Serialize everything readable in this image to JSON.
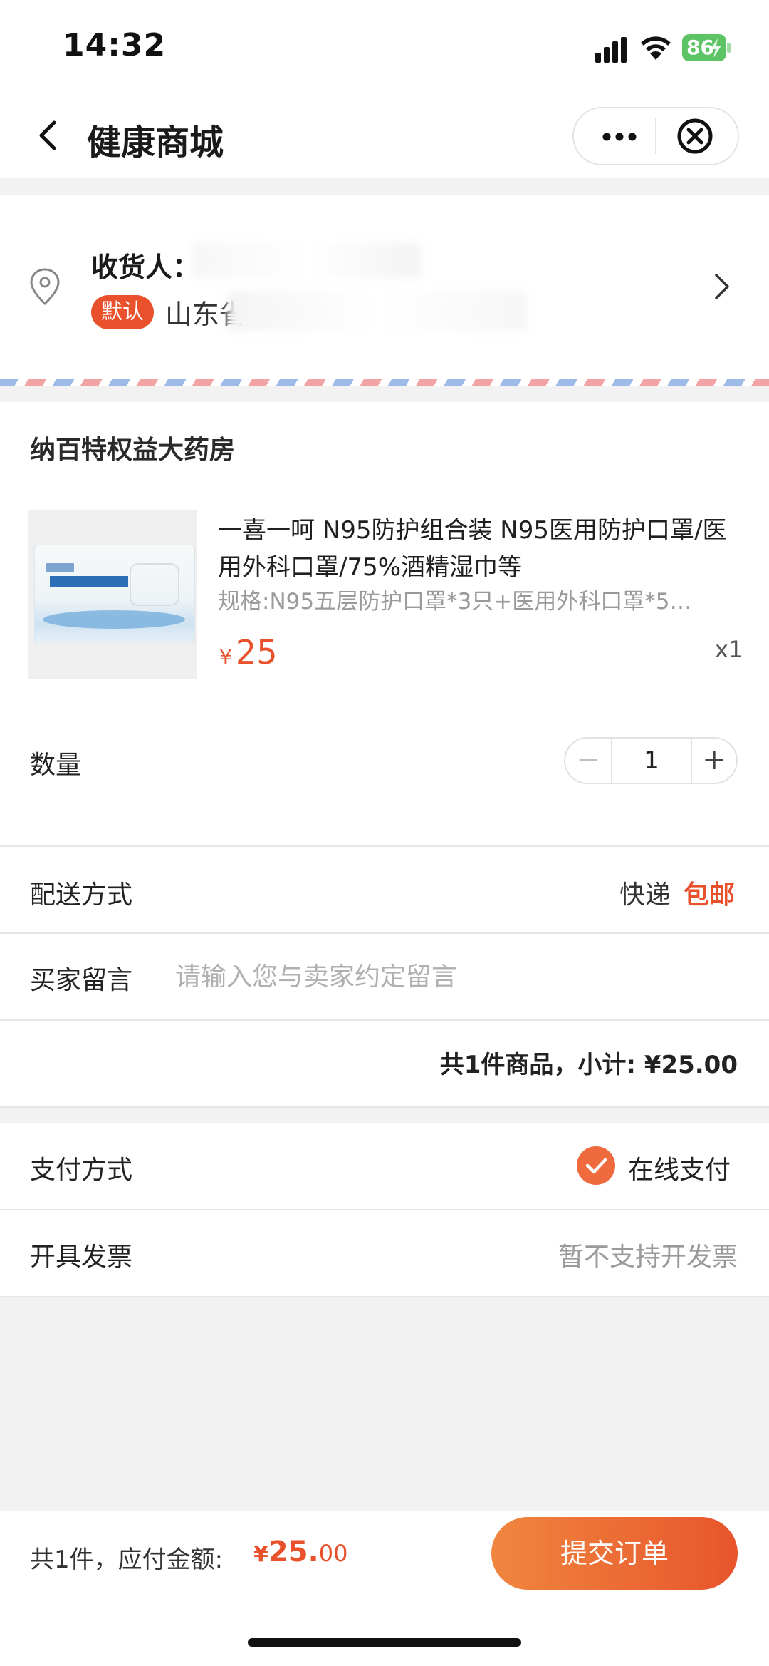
{
  "status": {
    "time": "14:32",
    "battery": "86"
  },
  "nav": {
    "title": "健康商城"
  },
  "address": {
    "receiver_label": "收货人：",
    "default_tag": "默认",
    "address_prefix": "山东省"
  },
  "store": {
    "name": "纳百特权益大药房",
    "product": {
      "title": "一喜一呵 N95防护组合装 N95医用防护口罩/医用外科口罩/75%酒精湿巾等",
      "spec": "规格:N95五层防护口罩*3只+医用外科口罩*5…",
      "currency": "¥",
      "price": "25",
      "count": "x1"
    },
    "quantity": {
      "label": "数量",
      "minus": "−",
      "value": "1",
      "plus": "+"
    }
  },
  "delivery": {
    "label": "配送方式",
    "method": "快递",
    "free": "包邮"
  },
  "message": {
    "label": "买家留言",
    "placeholder": "请输入您与卖家约定留言"
  },
  "subtotal": "共1件商品，小计: ¥25.00",
  "payment": {
    "label": "支付方式",
    "value": "在线支付"
  },
  "invoice": {
    "label": "开具发票",
    "value": "暂不支持开发票"
  },
  "footer": {
    "summary": "共1件，应付金额:",
    "currency": "¥",
    "amount_int": "25.",
    "amount_dec": "00",
    "submit": "提交订单"
  },
  "colors": {
    "accent": "#e8512b",
    "button_start": "#f0863f",
    "button_end": "#e8552c"
  }
}
